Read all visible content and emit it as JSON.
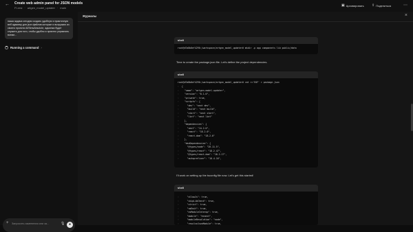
{
  "header": {
    "title": "Create web admin panel for JSON models",
    "crumbs": [
      "FI-resi",
      "artgen_model_updater",
      "main"
    ],
    "archive_label": "Архивировать",
    "share_label": "Поделиться"
  },
  "chat": {
    "user_message": "наша задача сегодня создать удобную и практичную веб админку для json файлов которые я выгружаю из своего проекта Al/SimsAbsolute, админка будет служить для того, чтобы удобно и приятно управлять всеми...",
    "task_status": "Running a command",
    "composer_placeholder": "Запросить изменения или за..."
  },
  "log_panel": {
    "title": "Журналы",
    "blocks": [
      {
        "header": "shell",
        "command": "root@d7a8b0ef4290:/workspace/artgen_model_updater# mkdir -p app components lib public/data",
        "lines": []
      },
      {
        "header": "shell",
        "command": "root@d7a8b0ef4290:/workspace/artgen_model_updater# cat <<'EOF' > package.json",
        "lines": [
          "{",
          "  \"name\": \"artgen-model-updater\",",
          "  \"version\": \"0.1.0\",",
          "  \"private\": true,",
          "  \"scripts\": {",
          "    \"dev\": \"next dev\",",
          "    \"build\": \"next build\",",
          "    \"start\": \"next start\",",
          "    \"lint\": \"next lint\"",
          "  },",
          "  \"dependencies\": {",
          "    \"next\": \"14.2.0\",",
          "    \"react\": \"18.2.0\",",
          "    \"react-dom\": \"18.2.0\"",
          "  },",
          "  \"devDependencies\": {",
          "    \"@types/node\": \"20.11.5\",",
          "    \"@types/react\": \"18.2.47\",",
          "    \"@types/react-dom\": \"18.2.17\",",
          "    \"autoprefixer\": \"10.4.16\","
        ]
      },
      {
        "header": "shell",
        "command": "",
        "lines": [
          "    \"allowJs\": true,",
          "    \"skipLibCheck\": true,",
          "    \"strict\": true,",
          "    \"noEmit\": true,",
          "    \"esModuleInterop\": true,",
          "    \"module\": \"esnext\",",
          "    \"moduleResolution\": \"node\",",
          "    \"resolveJsonModule\": true,",
          "    \"isolatedModules\": true,",
          "    \"jsx\": \"preserve\",",
          "    \"incremental\": true,"
        ]
      }
    ],
    "prose": [
      "Time to create the package.json file. Let's define the project dependencies.",
      "I'll work on setting up the tsconfig file now. Let's get this started!"
    ]
  },
  "icons": {
    "back": "arrow-left-icon",
    "archive": "archive-icon",
    "share": "share-icon",
    "more": "more-dots-icon",
    "close": "close-icon",
    "plus": "plus-icon",
    "mic": "mic-icon",
    "send": "send-icon"
  }
}
